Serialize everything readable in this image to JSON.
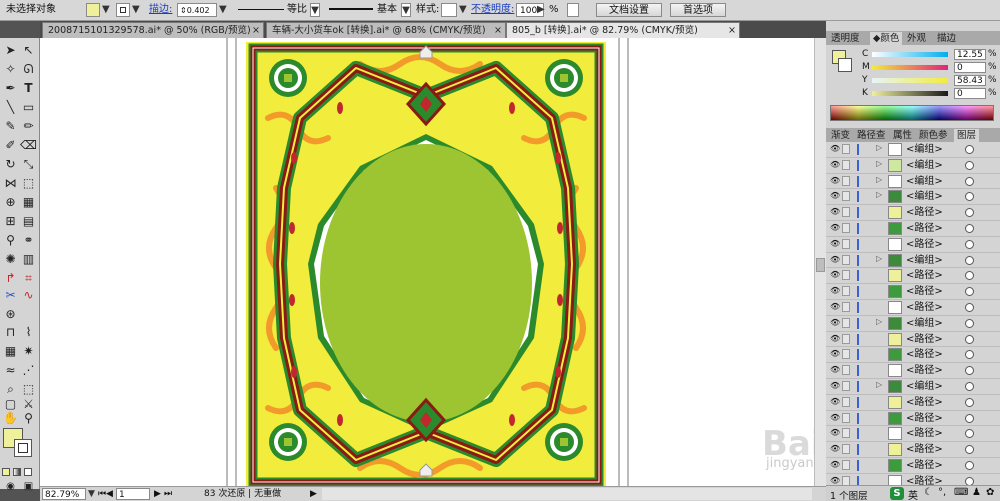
{
  "control": {
    "selection": "未选择对象",
    "stroke_label": "描边:",
    "stroke_value": "0.402",
    "profile": "等比",
    "brush": "基本",
    "style_label": "样式:",
    "opacity_label": "不透明度:",
    "opacity_value": "100",
    "percent": "%",
    "doc_setup": "文档设置",
    "prefs": "首选项"
  },
  "tabs": [
    {
      "label": "2008715101329578.ai* @ 50% (RGB/预览)",
      "close": "×"
    },
    {
      "label": "车辆-大小货车ok [转换].ai* @ 68% (CMYK/预览)",
      "close": "×"
    },
    {
      "label": "805_b [转换].ai* @ 82.79% (CMYK/预览)",
      "close": "×"
    }
  ],
  "status": {
    "zoom": "82.79%",
    "page": "1",
    "info": "83 次还原 | 无重做"
  },
  "color_panel": {
    "tabs": [
      "透明度",
      "颜色",
      "外观",
      "描边"
    ],
    "channels": [
      {
        "label": "C",
        "value": "12.55"
      },
      {
        "label": "M",
        "value": "0"
      },
      {
        "label": "Y",
        "value": "58.43"
      },
      {
        "label": "K",
        "value": "0"
      }
    ],
    "fill_color": "#eef09a"
  },
  "layers_panel": {
    "tabs": [
      "渐变",
      "路径查",
      "属性",
      "颜色参",
      "图层"
    ],
    "rows": [
      {
        "name": "<编组>",
        "thumb": "#ffffff",
        "expand": true
      },
      {
        "name": "<编组>",
        "thumb": "#cfe8a0",
        "expand": true
      },
      {
        "name": "<编组>",
        "thumb": "#ffffff",
        "expand": true
      },
      {
        "name": "<编组>",
        "thumb": "#3c8a3c",
        "expand": true
      },
      {
        "name": "<路径>",
        "thumb": "#eef09a",
        "expand": false
      },
      {
        "name": "<路径>",
        "thumb": "#3d9a3d",
        "expand": false
      },
      {
        "name": "<路径>",
        "thumb": "#ffffff",
        "expand": false
      },
      {
        "name": "<编组>",
        "thumb": "#3c8a3c",
        "expand": true
      },
      {
        "name": "<路径>",
        "thumb": "#eef09a",
        "expand": false
      },
      {
        "name": "<路径>",
        "thumb": "#3d9a3d",
        "expand": false
      },
      {
        "name": "<路径>",
        "thumb": "#ffffff",
        "expand": false
      },
      {
        "name": "<编组>",
        "thumb": "#3c8a3c",
        "expand": true
      },
      {
        "name": "<路径>",
        "thumb": "#eef09a",
        "expand": false
      },
      {
        "name": "<路径>",
        "thumb": "#3d9a3d",
        "expand": false
      },
      {
        "name": "<路径>",
        "thumb": "#ffffff",
        "expand": false
      },
      {
        "name": "<编组>",
        "thumb": "#3c8a3c",
        "expand": true
      },
      {
        "name": "<路径>",
        "thumb": "#eef09a",
        "expand": false
      },
      {
        "name": "<路径>",
        "thumb": "#3d9a3d",
        "expand": false
      },
      {
        "name": "<路径>",
        "thumb": "#ffffff",
        "expand": false
      },
      {
        "name": "<路径>",
        "thumb": "#eef09a",
        "expand": false
      },
      {
        "name": "<路径>",
        "thumb": "#3d9a3d",
        "expand": false
      },
      {
        "name": "<路径>",
        "thumb": "#ffffff",
        "expand": false
      },
      {
        "name": "<路径>",
        "thumb": "#eef09a",
        "expand": false
      },
      {
        "name": "<路径>",
        "thumb": "#eef09a",
        "expand": false,
        "selected": true
      }
    ],
    "footer": "1 个图层"
  },
  "watermark": {
    "main": "Baidu经验",
    "sub": "jingyan.baidu.com"
  },
  "tray": {
    "label": "英"
  },
  "colors": {
    "artboard_yellow": "#f2ec3c",
    "border_green": "#2b8a2b",
    "oval_green": "#9dc431",
    "frame_red": "#8a1a14",
    "ornament_orange": "#f29a2a"
  }
}
